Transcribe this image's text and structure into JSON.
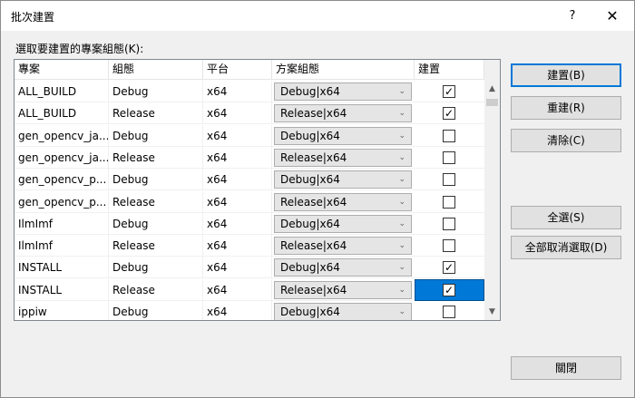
{
  "window": {
    "title": "批次建置",
    "help_label": "?",
    "close_label": "✕"
  },
  "prompt": "選取要建置的專案組態(K):",
  "table": {
    "headers": [
      "專案",
      "組態",
      "平台",
      "方案組態",
      "建置"
    ],
    "rows": [
      {
        "project": "ALL_BUILD",
        "config": "Debug",
        "platform": "x64",
        "solution": "Debug|x64",
        "build": true
      },
      {
        "project": "ALL_BUILD",
        "config": "Release",
        "platform": "x64",
        "solution": "Release|x64",
        "build": true
      },
      {
        "project": "gen_opencv_ja...",
        "config": "Debug",
        "platform": "x64",
        "solution": "Debug|x64",
        "build": false
      },
      {
        "project": "gen_opencv_ja...",
        "config": "Release",
        "platform": "x64",
        "solution": "Release|x64",
        "build": false
      },
      {
        "project": "gen_opencv_p...",
        "config": "Debug",
        "platform": "x64",
        "solution": "Debug|x64",
        "build": false
      },
      {
        "project": "gen_opencv_p...",
        "config": "Release",
        "platform": "x64",
        "solution": "Release|x64",
        "build": false
      },
      {
        "project": "IlmImf",
        "config": "Debug",
        "platform": "x64",
        "solution": "Debug|x64",
        "build": false
      },
      {
        "project": "IlmImf",
        "config": "Release",
        "platform": "x64",
        "solution": "Release|x64",
        "build": false
      },
      {
        "project": "INSTALL",
        "config": "Debug",
        "platform": "x64",
        "solution": "Debug|x64",
        "build": true
      },
      {
        "project": "INSTALL",
        "config": "Release",
        "platform": "x64",
        "solution": "Release|x64",
        "build": true,
        "selected": true
      },
      {
        "project": "ippiw",
        "config": "Debug",
        "platform": "x64",
        "solution": "Debug|x64",
        "build": false
      }
    ]
  },
  "buttons": {
    "build": "建置(B)",
    "rebuild": "重建(R)",
    "clean": "清除(C)",
    "select_all": "全選(S)",
    "deselect_all": "全部取消選取(D)",
    "close": "關閉"
  },
  "colors": {
    "selection": "#0078d7",
    "default_button_border": "#0078d7"
  },
  "icons": {
    "checkbox_checked": "check-icon",
    "combo_arrow": "chevron-down-icon"
  }
}
